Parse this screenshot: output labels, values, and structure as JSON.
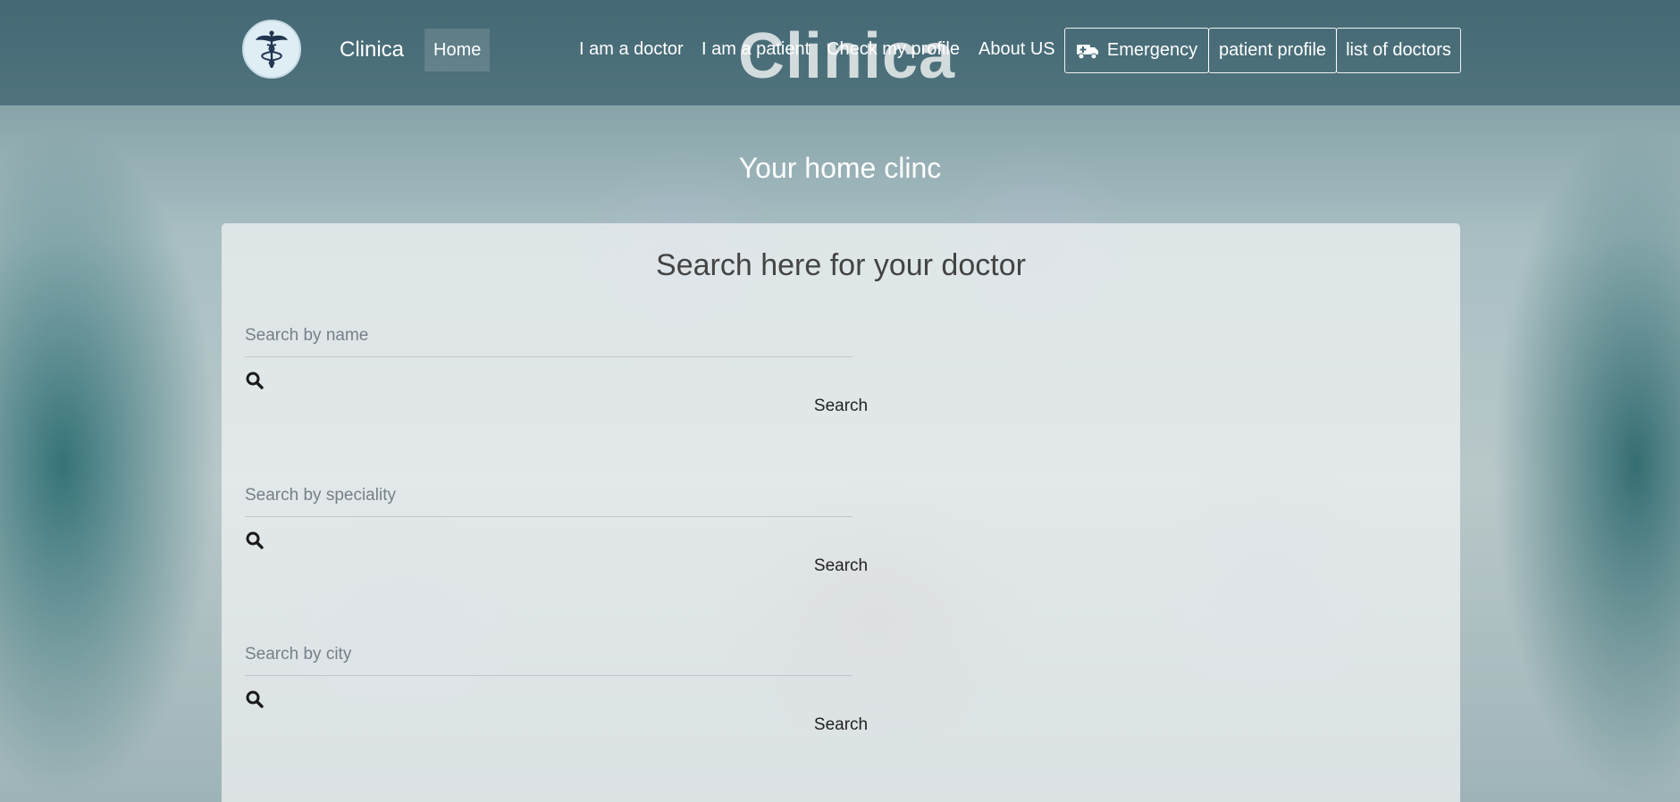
{
  "navbar": {
    "brand": "Clinica",
    "home": "Home",
    "watermark": "Clinica",
    "links": {
      "doctor": "I am a doctor",
      "patient": "I am a patient",
      "check_profile": "Check my profile",
      "about": "About US"
    },
    "buttons": {
      "emergency": "Emergency",
      "patient_profile": "patient profile",
      "list_doctors": "list of doctors"
    },
    "logo_icon": "caduceus-icon",
    "emergency_icon": "ambulance-icon"
  },
  "hero": {
    "subtitle": "Your home clinc"
  },
  "search_panel": {
    "title": "Search here for your doctor",
    "groups": [
      {
        "placeholder": "Search by name",
        "button": "Search",
        "icon": "search-icon"
      },
      {
        "placeholder": "Search by speciality",
        "button": "Search",
        "icon": "search-icon"
      },
      {
        "placeholder": "Search by city",
        "button": "Search",
        "icon": "search-icon"
      }
    ]
  },
  "colors": {
    "navbar_bg": "#234b5a",
    "panel_bg": "#f2f4f5",
    "title_text": "#444444",
    "icon": "#1a1a1a"
  }
}
